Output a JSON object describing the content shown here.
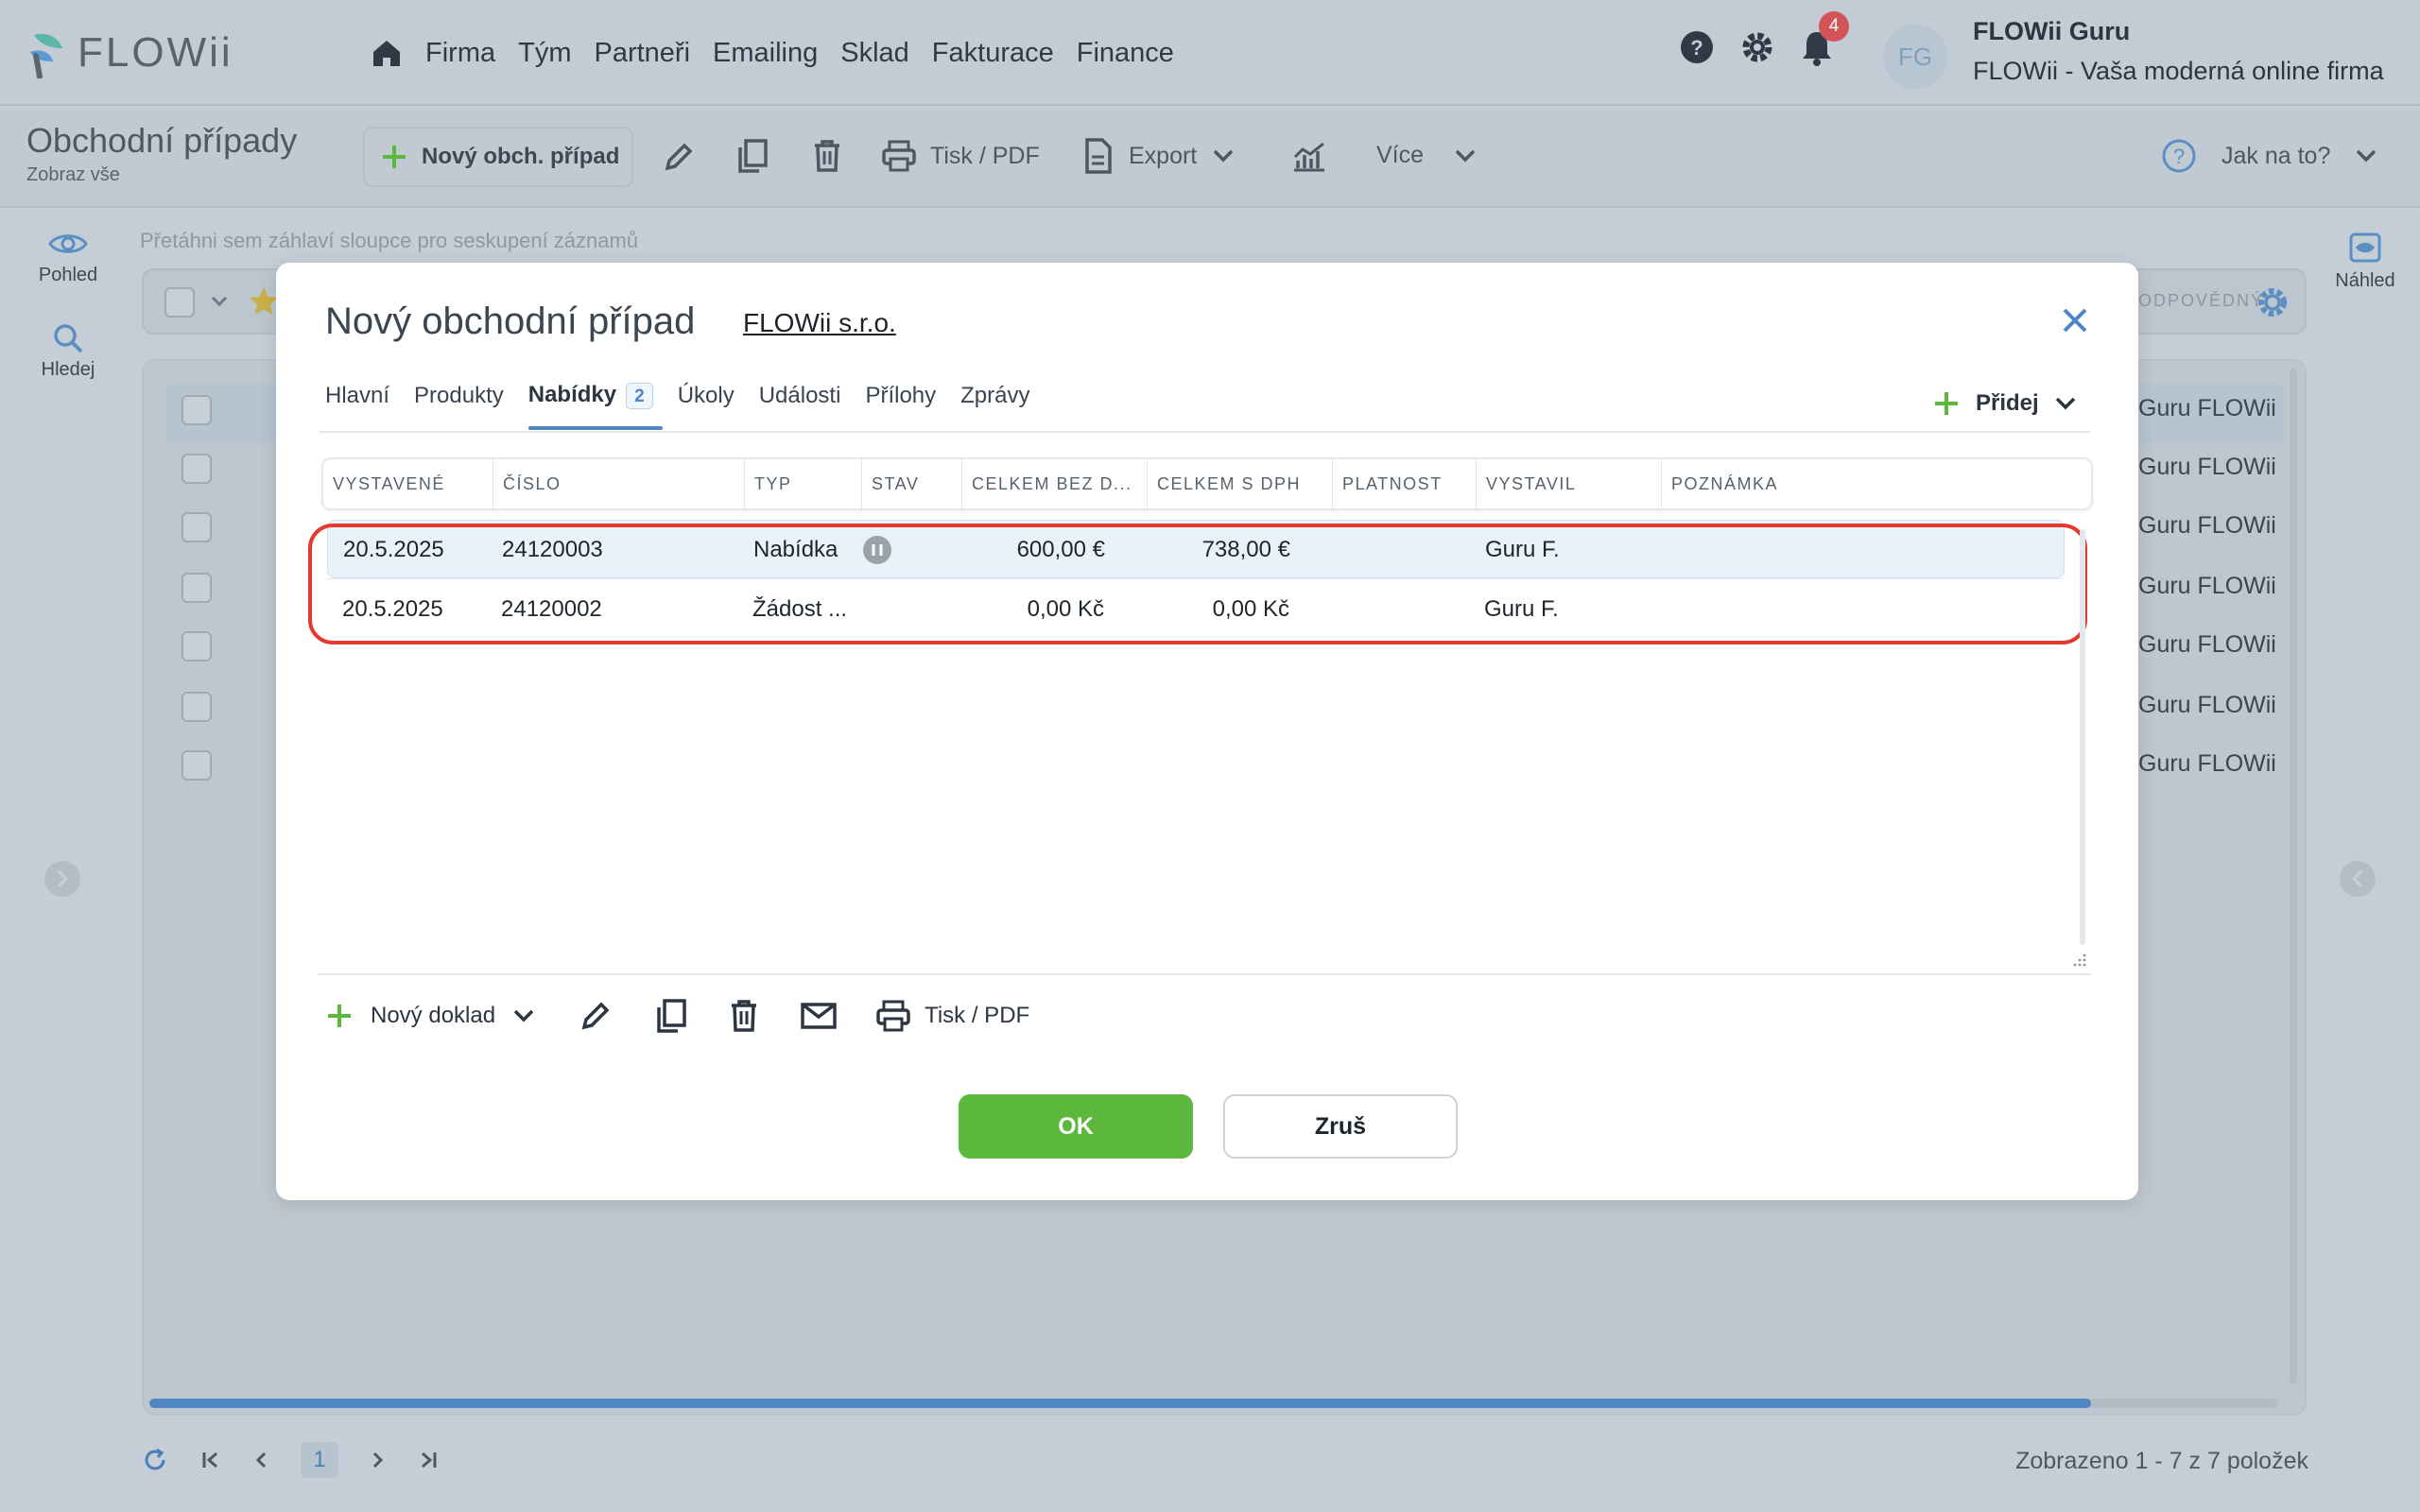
{
  "app": {
    "logo": "FLOWii"
  },
  "nav": {
    "items": [
      "Firma",
      "Tým",
      "Partneři",
      "Emailing",
      "Sklad",
      "Fakturace",
      "Finance"
    ]
  },
  "notifications": {
    "count": "4"
  },
  "user": {
    "initials": "FG",
    "name": "FLOWii Guru",
    "company": "FLOWii - Vaša moderná online firma"
  },
  "page": {
    "title": "Obchodní případy",
    "subtitle": "Zobraz vše"
  },
  "toolbar": {
    "new_label": "Nový obch. případ",
    "print_label": "Tisk / PDF",
    "export_label": "Export",
    "more_label": "Více",
    "help_label": "Jak na to?"
  },
  "left_side": {
    "view_label": "Pohled",
    "search_label": "Hledej"
  },
  "right_side": {
    "preview_label": "Náhled"
  },
  "list": {
    "group_hint": "Přetáhni sem záhlaví sloupce pro seskupení záznamů",
    "column_fragment": "ODPOVĚDNÝ",
    "responsible": [
      "Guru FLOWii",
      "Guru FLOWii",
      "Guru FLOWii",
      "Guru FLOWii",
      "Guru FLOWii",
      "Guru FLOWii",
      "Guru FLOWii"
    ],
    "page": "1",
    "summary": "Zobrazeno 1 - 7 z 7 položek"
  },
  "modal": {
    "title": "Nový obchodní případ",
    "company": "FLOWii s.r.o.",
    "tabs": [
      {
        "label": "Hlavní"
      },
      {
        "label": "Produkty"
      },
      {
        "label": "Nabídky",
        "badge": "2"
      },
      {
        "label": "Úkoly"
      },
      {
        "label": "Události"
      },
      {
        "label": "Přílohy"
      },
      {
        "label": "Zprávy"
      }
    ],
    "add_label": "Přidej",
    "columns": [
      "VYSTAVENÉ",
      "ČÍSLO",
      "TYP",
      "STAV",
      "CELKEM BEZ D...",
      "CELKEM S DPH",
      "PLATNOST",
      "VYSTAVIL",
      "POZNÁMKA"
    ],
    "rows": [
      {
        "issued": "20.5.2025",
        "number": "24120003",
        "type": "Nabídka",
        "total_net": "600,00 €",
        "total_vat": "738,00 €",
        "validity": "",
        "issued_by": "Guru F.",
        "note": ""
      },
      {
        "issued": "20.5.2025",
        "number": "24120002",
        "type": "Žádost ...",
        "total_net": "0,00 Kč",
        "total_vat": "0,00 Kč",
        "validity": "",
        "issued_by": "Guru F.",
        "note": ""
      }
    ],
    "new_doc_label": "Nový doklad",
    "print_label": "Tisk / PDF",
    "ok_label": "OK",
    "cancel_label": "Zruš"
  },
  "colors": {
    "accent": "#4e86c2",
    "ok": "#5cb83c",
    "highlight": "#e5382e"
  }
}
